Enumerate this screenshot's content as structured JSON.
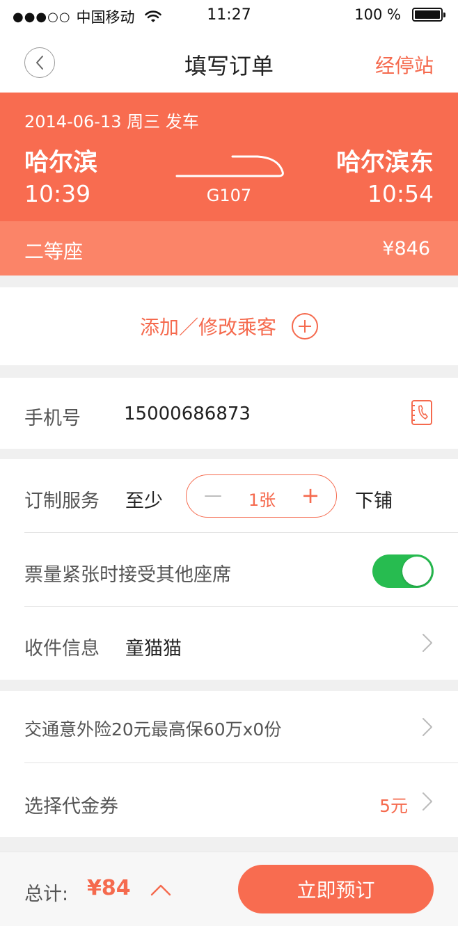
{
  "status_bar": {
    "signal_dots": "●●●○○",
    "carrier": "中国移动",
    "time": "11:27",
    "battery_text": "100 %"
  },
  "nav": {
    "title": "填写订单",
    "right_link": "经停站"
  },
  "trip": {
    "date": "2014-06-13 周三 发车",
    "from_station": "哈尔滨",
    "to_station": "哈尔滨东",
    "departure_time": "10:39",
    "arrival_time": "10:54",
    "train_number": "G107",
    "seat_class": "二等座",
    "price": "¥846"
  },
  "passenger": {
    "add_label": "添加／修改乘客"
  },
  "phone": {
    "label": "手机号",
    "value": "15000686873"
  },
  "service": {
    "label": "订制服务",
    "at_least": "至少",
    "minus": "—",
    "quantity": "1张",
    "plus": "+",
    "berth": "下铺",
    "accept_other_label": "票量紧张时接受其他座席",
    "accept_other_enabled": true,
    "receive_label": "收件信息",
    "receive_value": "童猫猫"
  },
  "extras": {
    "insurance_label": "交通意外险20元最高保60万x0份",
    "voucher_label": "选择代金券",
    "voucher_value": "5元"
  },
  "bottom": {
    "total_label": "总计:",
    "total_amount": "¥84",
    "book_button": "立即预订"
  },
  "colors": {
    "accent": "#f86c50",
    "accent_light": "#fb8468",
    "toggle_on": "#27bc50"
  },
  "icons": [
    "back-chevron-icon",
    "plus-circle-icon",
    "contact-book-icon",
    "chevron-right-icon",
    "chevron-up-icon",
    "wifi-icon",
    "battery-icon",
    "train-icon"
  ]
}
